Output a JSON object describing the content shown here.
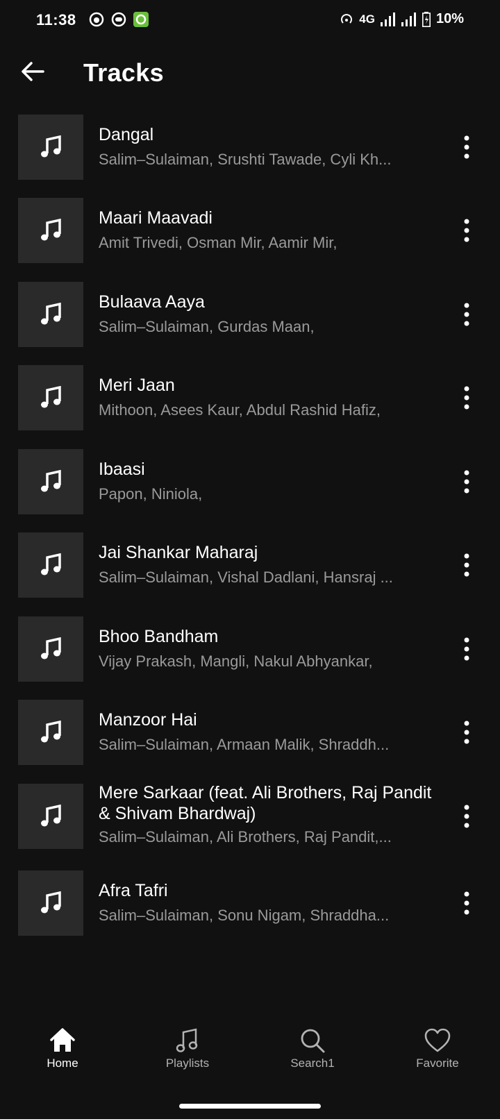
{
  "status_bar": {
    "time": "11:38",
    "network": "4G",
    "battery": "10%",
    "left_icons": [
      "pocket-casts-icon",
      "assistant-icon",
      "green-app-icon"
    ],
    "right_icons": [
      "hotspot-icon",
      "signal-icon",
      "signal-icon",
      "battery-icon"
    ]
  },
  "header": {
    "title": "Tracks",
    "back_icon": "back-arrow-icon"
  },
  "tracks": [
    {
      "title": "Dangal",
      "artists": "Salim–Sulaiman, Srushti Tawade, Cyli Kh..."
    },
    {
      "title": "Maari Maavadi",
      "artists": "Amit Trivedi, Osman Mir, Aamir Mir,"
    },
    {
      "title": "Bulaava Aaya",
      "artists": "Salim–Sulaiman, Gurdas Maan,"
    },
    {
      "title": "Meri Jaan",
      "artists": "Mithoon, Asees Kaur, Abdul Rashid Hafiz,"
    },
    {
      "title": "Ibaasi",
      "artists": "Papon, Niniola,"
    },
    {
      "title": "Jai Shankar Maharaj",
      "artists": "Salim–Sulaiman, Vishal Dadlani, Hansraj ..."
    },
    {
      "title": "Bhoo Bandham",
      "artists": "Vijay Prakash, Mangli, Nakul Abhyankar,"
    },
    {
      "title": "Manzoor Hai",
      "artists": "Salim–Sulaiman, Armaan Malik, Shraddh..."
    },
    {
      "title": "Mere Sarkaar (feat. Ali Brothers, Raj Pandit & Shivam Bhardwaj)",
      "artists": "Salim–Sulaiman, Ali Brothers, Raj Pandit,..."
    },
    {
      "title": "Afra Tafri",
      "artists": "Salim–Sulaiman, Sonu Nigam, Shraddha..."
    }
  ],
  "bottom_nav": {
    "items": [
      {
        "label": "Home",
        "icon": "home-icon",
        "active": true
      },
      {
        "label": "Playlists",
        "icon": "music-note-icon",
        "active": false
      },
      {
        "label": "Search1",
        "icon": "search-icon",
        "active": false
      },
      {
        "label": "Favorite",
        "icon": "heart-icon",
        "active": false
      }
    ]
  },
  "colors": {
    "background": "#111111",
    "thumbnail": "#2a2a2a",
    "primary_text": "#ffffff",
    "secondary_text": "#9a9a9a",
    "inactive_nav": "#b3b3b3"
  }
}
